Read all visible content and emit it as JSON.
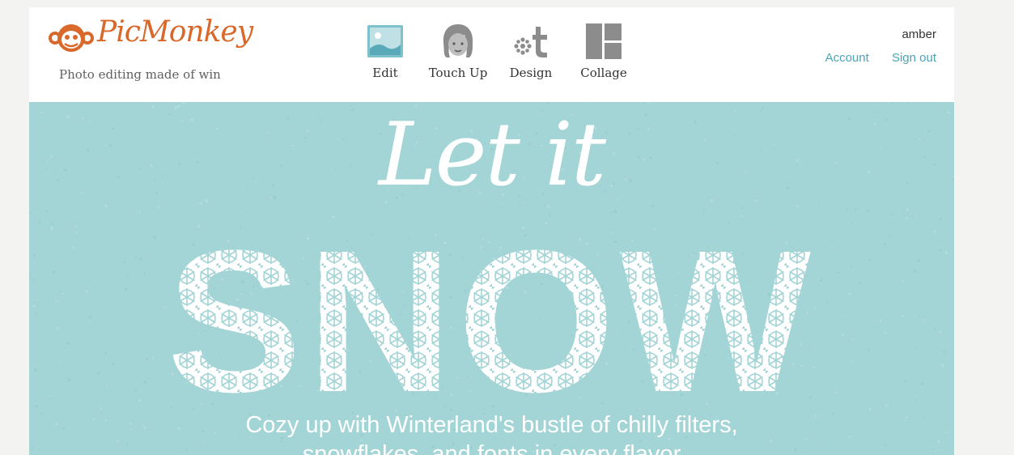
{
  "brand": {
    "name": "PicMonkey",
    "tagline": "Photo editing made of win",
    "color": "#d9692b"
  },
  "nav": {
    "items": [
      {
        "label": "Edit",
        "icon": "landscape-photo-icon"
      },
      {
        "label": "Touch Up",
        "icon": "face-icon"
      },
      {
        "label": "Design",
        "icon": "design-icon"
      },
      {
        "label": "Collage",
        "icon": "collage-grid-icon"
      }
    ]
  },
  "user": {
    "name": "amber",
    "account_label": "Account",
    "signout_label": "Sign out",
    "link_color": "#4aa5b6"
  },
  "banner": {
    "script_text": "Let it",
    "headline": "SNOW",
    "subtitle_line1": "Cozy up with Winterland's bustle of chilly filters,",
    "subtitle_line2": "snowflakes, and fonts in every flavor",
    "background": "#a3d4d6"
  }
}
